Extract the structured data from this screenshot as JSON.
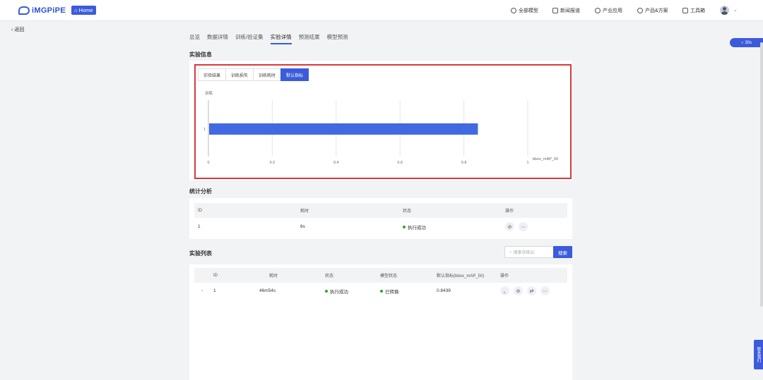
{
  "header": {
    "logo_text": "iMGPiPE",
    "home_label": "Home",
    "nav": [
      {
        "label": "全部模型",
        "icon": "cube-icon"
      },
      {
        "label": "新闻报道",
        "icon": "news-icon"
      },
      {
        "label": "产业应用",
        "icon": "gear-icon"
      },
      {
        "label": "产品&方案",
        "icon": "bulb-icon"
      },
      {
        "label": "工具箱",
        "icon": "toolbox-icon"
      }
    ]
  },
  "back_label": "返回",
  "timer_label": "30s",
  "contact_label": "联系我们",
  "tabs": [
    "总览",
    "数据详情",
    "训练/验证集",
    "实验详情",
    "预测结果",
    "模型预测"
  ],
  "active_tab": 3,
  "sections": {
    "experiment_info": "实验信息",
    "statistics": "统计分析",
    "experiment_list": "实验列表"
  },
  "info_subtabs": [
    "实验结果",
    "训练损失",
    "训练耗时",
    "默认指标"
  ],
  "active_subtab": 3,
  "chart_data": {
    "type": "bar",
    "orientation": "horizontal",
    "title": "",
    "ylabel": "训练",
    "xlabel": "bbox_mAP_50",
    "categories": [
      "1"
    ],
    "values": [
      0.8439
    ],
    "xlim": [
      0,
      1
    ],
    "xticks": [
      "0",
      "0.2",
      "0.4",
      "0.6",
      "0.8",
      "1"
    ],
    "grid": true,
    "color": "#4169e1"
  },
  "stats_table": {
    "headers": [
      "ID",
      "耗时",
      "状态",
      "操作"
    ],
    "rows": [
      {
        "id": "1",
        "time": "6s",
        "status": "执行成功"
      }
    ]
  },
  "search": {
    "placeholder": "搜索训练ID",
    "button": "搜索"
  },
  "list_table": {
    "headers": [
      "ID",
      "耗时",
      "状态",
      "模型状态",
      "默认指标(bbox_mAP_50)",
      "操作"
    ],
    "rows": [
      {
        "expand": "›",
        "id": "1",
        "time": "46m54s",
        "status": "执行成功",
        "model_status": "已转换",
        "metric": "0.8439"
      }
    ]
  },
  "colors": {
    "accent": "#3b5bdb",
    "success": "#22a83a",
    "highlight_border": "#d9383a"
  }
}
